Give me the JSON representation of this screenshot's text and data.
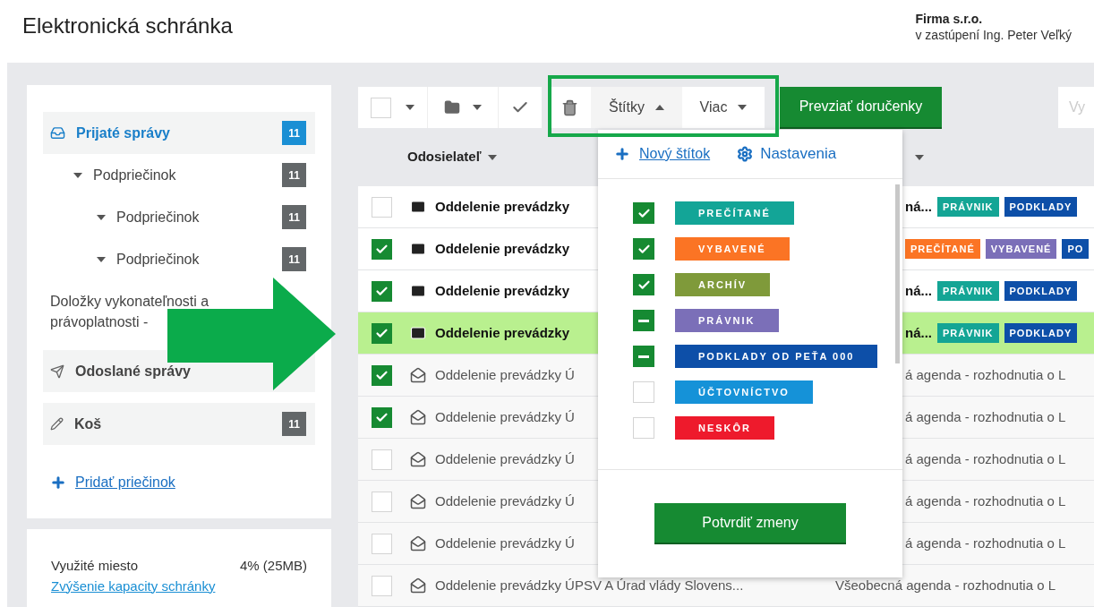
{
  "header": {
    "title": "Elektronická schránka",
    "account_name": "Firma s.r.o.",
    "representative": "v zastúpení Ing. Peter Veľký"
  },
  "sidebar": {
    "folders": [
      {
        "label": "Prijaté správy",
        "kind": "inbox",
        "count": "11",
        "selected": true,
        "children": [
          {
            "label": "Podpriečinok",
            "count": "11",
            "selected": false,
            "expanded": true,
            "children": [
              {
                "label": "Podpriečinok",
                "count": "11",
                "selected": false,
                "expanded": true
              },
              {
                "label": "Podpriečinok",
                "count": "11",
                "selected": false,
                "expanded": true
              }
            ]
          }
        ]
      },
      {
        "label": "Doložky vykonateľnosti a právoplatnosti -",
        "selected": false
      },
      {
        "label": "Odoslané správy",
        "kind": "sent",
        "selected": false
      },
      {
        "label": "Koš",
        "kind": "trash",
        "count": "11",
        "selected": false
      }
    ],
    "add_folder": "Pridať priečinok"
  },
  "storage": {
    "label": "Využité miesto",
    "value": "4% (25MB)",
    "link": "Zvýšenie kapacity schránky"
  },
  "toolbar": {
    "select_all_checked": false,
    "labels_button": {
      "label": "Štítky",
      "expanded": true
    },
    "more_button": {
      "label": "Viac",
      "expanded": false
    },
    "receipts_button": "Prevziať doručenky",
    "search": {
      "placeholder": "Vy"
    }
  },
  "table": {
    "columns": [
      {
        "label": "Odosielateľ"
      }
    ],
    "rows": [
      {
        "checked": false,
        "selected": false,
        "unread": true,
        "sender": "Oddelenie prevádzky",
        "subject": "ná...",
        "tags": [
          {
            "label": "PRÁVNIK",
            "color": "#14a595"
          },
          {
            "label": "PODKLADY",
            "color": "#0d4fa8"
          }
        ]
      },
      {
        "checked": true,
        "selected": false,
        "unread": true,
        "sender": "Oddelenie prevádzky",
        "tags": [
          {
            "label": "PREČÍTANÉ",
            "color": "#fb7424"
          },
          {
            "label": "VYBAVENÉ",
            "color": "#7b6fb8"
          },
          {
            "label": "PO",
            "color": "#0d4fa8"
          }
        ]
      },
      {
        "checked": true,
        "selected": false,
        "unread": true,
        "sender": "Oddelenie prevádzky",
        "subject": "ná...",
        "tags": [
          {
            "label": "PRÁVNIK",
            "color": "#14a595"
          },
          {
            "label": "PODKLADY",
            "color": "#0d4fa8"
          }
        ]
      },
      {
        "checked": true,
        "selected": true,
        "unread": true,
        "sender": "Oddelenie prevádzky",
        "subject": "ná...",
        "tags": [
          {
            "label": "PRÁVNIK",
            "color": "#14a595"
          },
          {
            "label": "PODKLADY",
            "color": "#0d4fa8"
          }
        ]
      },
      {
        "checked": true,
        "selected": false,
        "unread": false,
        "sender": "Oddelenie prevádzky Ú",
        "subject": "á agenda - rozhodnutia o L"
      },
      {
        "checked": true,
        "selected": false,
        "unread": false,
        "sender": "Oddelenie prevádzky Ú",
        "subject": "á agenda - rozhodnutia o L"
      },
      {
        "checked": false,
        "selected": false,
        "unread": false,
        "sender": "Oddelenie prevádzky Ú",
        "subject": "á agenda - rozhodnutia o L"
      },
      {
        "checked": false,
        "selected": false,
        "unread": false,
        "sender": "Oddelenie prevádzky Ú",
        "subject": "á agenda - rozhodnutia o L"
      },
      {
        "checked": false,
        "selected": false,
        "unread": false,
        "sender": "Oddelenie prevádzky Ú",
        "subject": "á agenda - rozhodnutia o L"
      },
      {
        "checked": false,
        "selected": false,
        "unread": false,
        "sender": "Oddelenie prevádzky ÚPSV A Úrad vlády Slovens...",
        "subject": "Všeobecná agenda - rozhodnutia o L"
      }
    ]
  },
  "label_menu": {
    "new_label": "Nový štítok",
    "settings": "Nastavenia",
    "labels": [
      {
        "label": "PREČÍTANÉ",
        "color": "#13a597",
        "checked": true,
        "indeterminate": false
      },
      {
        "label": "VYBAVENÉ",
        "color": "#fb7424",
        "checked": true,
        "indeterminate": false
      },
      {
        "label": "ARCHÍV",
        "color": "#7f9a3a",
        "checked": true,
        "indeterminate": false
      },
      {
        "label": "PRÁVNIK",
        "color": "#7b6fb8",
        "checked": false,
        "indeterminate": true
      },
      {
        "label": "PODKLADY OD PEŤA 000",
        "color": "#0d4fa8",
        "checked": false,
        "indeterminate": true
      },
      {
        "label": "ÚČTOVNÍCTVO",
        "color": "#1592d8",
        "checked": false,
        "indeterminate": false
      },
      {
        "label": "NESKÔR",
        "color": "#ee1a2c",
        "checked": false,
        "indeterminate": false
      }
    ],
    "confirm": "Potvrdiť zmeny"
  }
}
